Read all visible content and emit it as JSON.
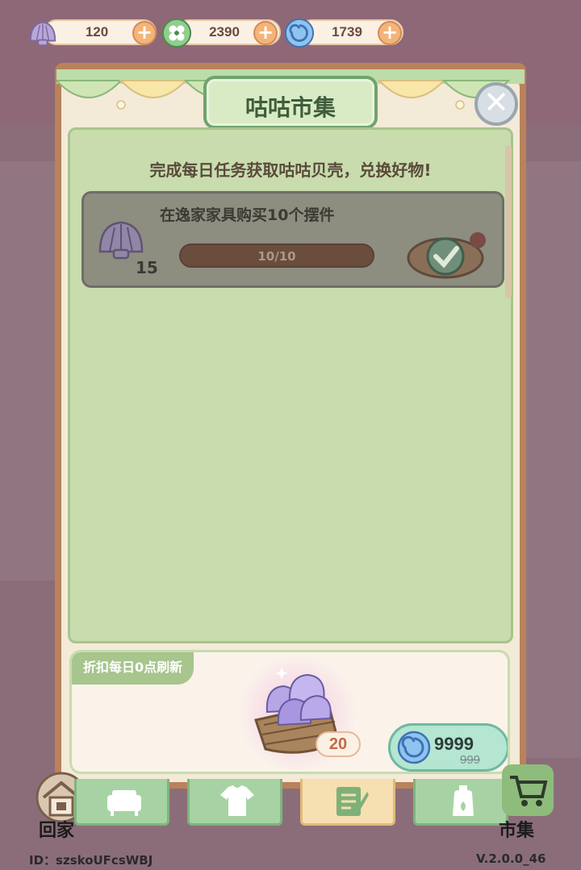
{
  "currencies": [
    {
      "icon": "shell-icon",
      "value": "120"
    },
    {
      "icon": "clover-icon",
      "value": "2390"
    },
    {
      "icon": "swirl-coin-icon",
      "value": "1739"
    }
  ],
  "panel": {
    "title": "咕咕市集",
    "subtitle": "完成每日任务获取咕咕贝壳，兑换好物!"
  },
  "task": {
    "name": "在逸家家具购买10个摆件",
    "reward": "15",
    "progress_label": "10/10",
    "progress": 1.0,
    "status": "completed"
  },
  "sale": {
    "tag": "折扣每日0点刷新",
    "quantity": "20",
    "price": "9999",
    "old_price": "999"
  },
  "nav": {
    "home_label": "回家",
    "market_label": "市集",
    "tabs": [
      {
        "icon": "sofa-icon",
        "active": false
      },
      {
        "icon": "shirt-icon",
        "active": false
      },
      {
        "icon": "task-list-icon",
        "active": true
      },
      {
        "icon": "bottle-icon",
        "active": false
      }
    ]
  },
  "footer": {
    "id": "ID：szskoUFcsWBJ",
    "version": "V.2.0.0_46"
  },
  "colors": {
    "accent_green": "#a7c58d",
    "frame_brown": "#b9825a",
    "content_green": "#c8dcae"
  }
}
